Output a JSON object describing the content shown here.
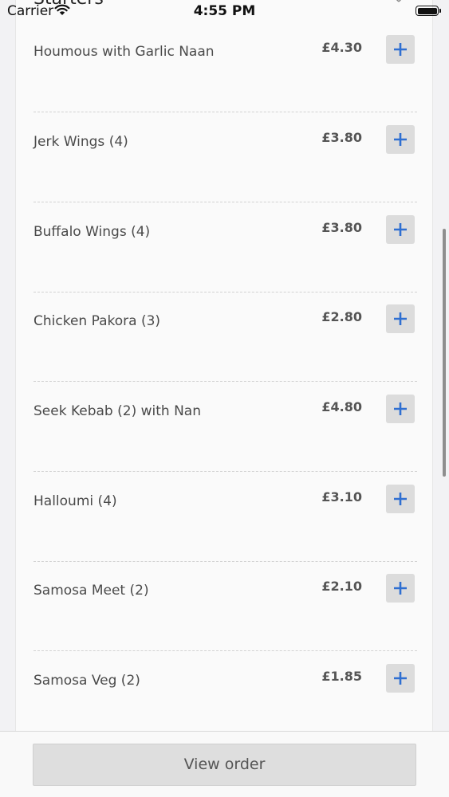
{
  "status_bar": {
    "carrier": "Carrier",
    "time": "4:55 PM"
  },
  "sheet": {
    "title": "Starters"
  },
  "menu": {
    "items": [
      {
        "name": "Houmous with Garlic Naan",
        "price": "£4.30"
      },
      {
        "name": "Jerk Wings (4)",
        "price": "£3.80"
      },
      {
        "name": "Buffalo Wings (4)",
        "price": "£3.80"
      },
      {
        "name": "Chicken Pakora (3)",
        "price": "£2.80"
      },
      {
        "name": "Seek Kebab (2) with Nan",
        "price": "£4.80"
      },
      {
        "name": "Halloumi (4)",
        "price": "£3.10"
      },
      {
        "name": "Samosa Meet (2)",
        "price": "£2.10"
      },
      {
        "name": "Samosa Veg (2)",
        "price": "£1.85"
      }
    ]
  },
  "footer": {
    "view_order_label": "View order"
  },
  "colors": {
    "accent_blue": "#2f6fd1",
    "button_gray": "#dcdcdc"
  },
  "icons": {
    "add": "plus-icon",
    "close": "close-icon",
    "wifi": "wifi-icon",
    "battery": "battery-icon"
  }
}
